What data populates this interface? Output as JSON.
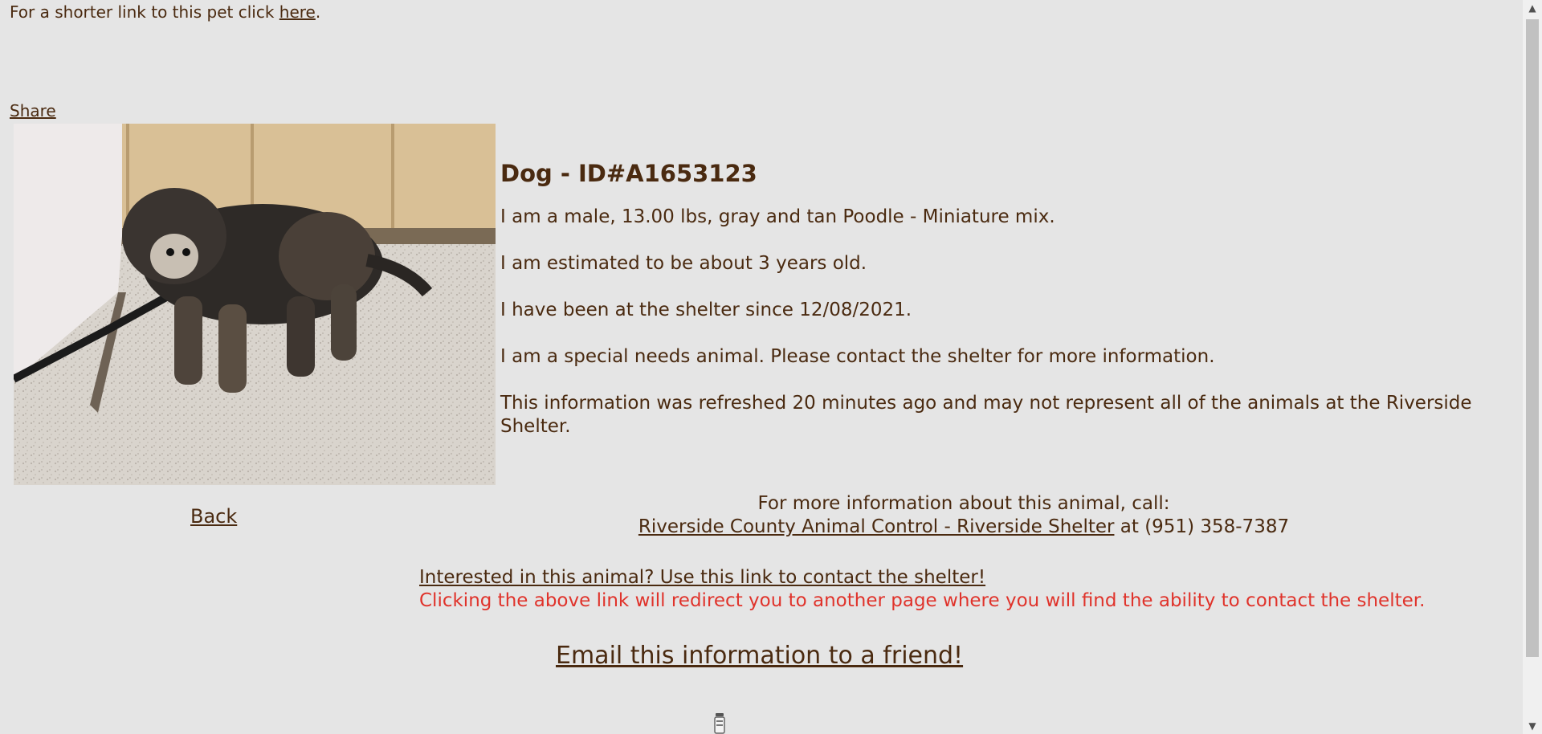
{
  "shortlink": {
    "prefix": "For a shorter link to this pet click ",
    "link_label": "here",
    "suffix": "."
  },
  "share_label": "Share",
  "photo": {
    "alt": "Photo of a gray and tan Poodle - Miniature mix on a leash"
  },
  "animal": {
    "title": "Dog - ID#A1653123",
    "description": "I am a male, 13.00 lbs, gray and tan Poodle - Miniature mix.",
    "age": "I am estimated to be about 3 years old.",
    "since": "I have been at the shelter since 12/08/2021.",
    "special_needs": "I am a special needs animal. Please contact the shelter for more information.",
    "refresh_note": "This information was refreshed 20 minutes ago and may not represent all of the animals at the Riverside Shelter."
  },
  "back_label": "Back",
  "contact": {
    "call_intro": "For more information about this animal, call:",
    "shelter_link": "Riverside County Animal Control - Riverside Shelter",
    "phone_text": " at (951) 358-7387"
  },
  "interest": {
    "link_label": "Interested in this animal? Use this link to contact the shelter!",
    "warning": "Clicking the above link will redirect you to another page where you will find the ability to contact the shelter."
  },
  "email_label": "Email this information to a friend!",
  "colors": {
    "background": "#e5e5e5",
    "text": "#4a2a10",
    "warning": "#e0332b"
  }
}
